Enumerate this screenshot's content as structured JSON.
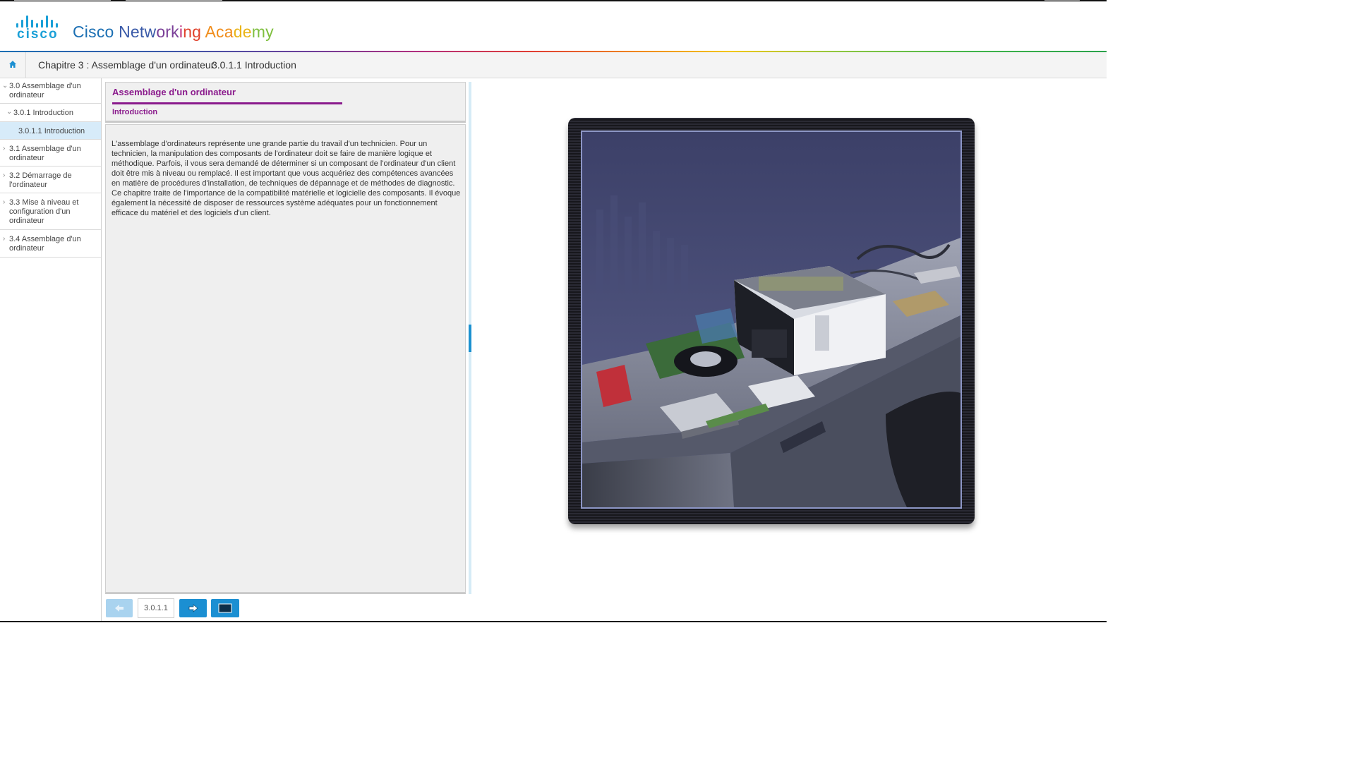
{
  "header": {
    "logo_text": "cisco",
    "academy_parts": [
      {
        "text": "Cisco ",
        "color": "#1b6fb3"
      },
      {
        "text": "Netw",
        "color": "#3a5aa8"
      },
      {
        "text": "ork",
        "color": "#7a3f98"
      },
      {
        "text": "i",
        "color": "#c0307a"
      },
      {
        "text": "ng ",
        "color": "#e0422c"
      },
      {
        "text": "Aca",
        "color": "#f08c1a"
      },
      {
        "text": "de",
        "color": "#e9b417"
      },
      {
        "text": "my",
        "color": "#7fbf3f"
      }
    ]
  },
  "breadcrumb": {
    "home_icon": "home-icon",
    "chapter": "Chapitre 3 : Assemblage d'un ordinateur",
    "separator": "›",
    "current": "3.0.1.1 Introduction"
  },
  "sidebar": {
    "items": [
      {
        "label": "3.0 Assemblage d'un ordinateur",
        "chevron": "⌄",
        "expanded": true
      },
      {
        "label": "3.0.1 Introduction",
        "chevron": "⌄",
        "expanded": true
      },
      {
        "label": "3.0.1.1 Introduction",
        "chevron": "",
        "active": true
      },
      {
        "label": "3.1 Assemblage d'un ordinateur",
        "chevron": "›"
      },
      {
        "label": "3.2 Démarrage de l'ordinateur",
        "chevron": "›"
      },
      {
        "label": "3.3 Mise à niveau et configuration d'un ordinateur",
        "chevron": "›"
      },
      {
        "label": "3.4 Assemblage d'un ordinateur",
        "chevron": "›"
      }
    ]
  },
  "content": {
    "title": "Assemblage d'un ordinateur",
    "subtitle": "Introduction",
    "body": "L'assemblage d'ordinateurs représente une grande partie du travail d'un technicien. Pour un technicien, la manipulation des composants de l'ordinateur doit se faire de manière logique et méthodique. Parfois, il vous sera demandé de déterminer si un composant de l'ordinateur d'un client doit être mis à niveau ou remplacé. Il est important que vous acquériez des compétences avancées en matière de procédures d'installation, de techniques de dépannage et de méthodes de diagnostic. Ce chapitre traite de l'importance de la compatibilité matérielle et logicielle des composants. Il évoque également la nécessité de disposer de ressources système adéquates pour un fonctionnement efficace du matériel et des logiciels d'un client."
  },
  "footer": {
    "prev_icon": "arrow-left-icon",
    "page": "3.0.1.1",
    "next_icon": "arrow-right-icon",
    "media_icon": "media-view-icon"
  },
  "colors": {
    "accent_blue": "#1b8fd2",
    "title_purple": "#8a1a8c",
    "active_item_bg": "#d7ebf9"
  }
}
